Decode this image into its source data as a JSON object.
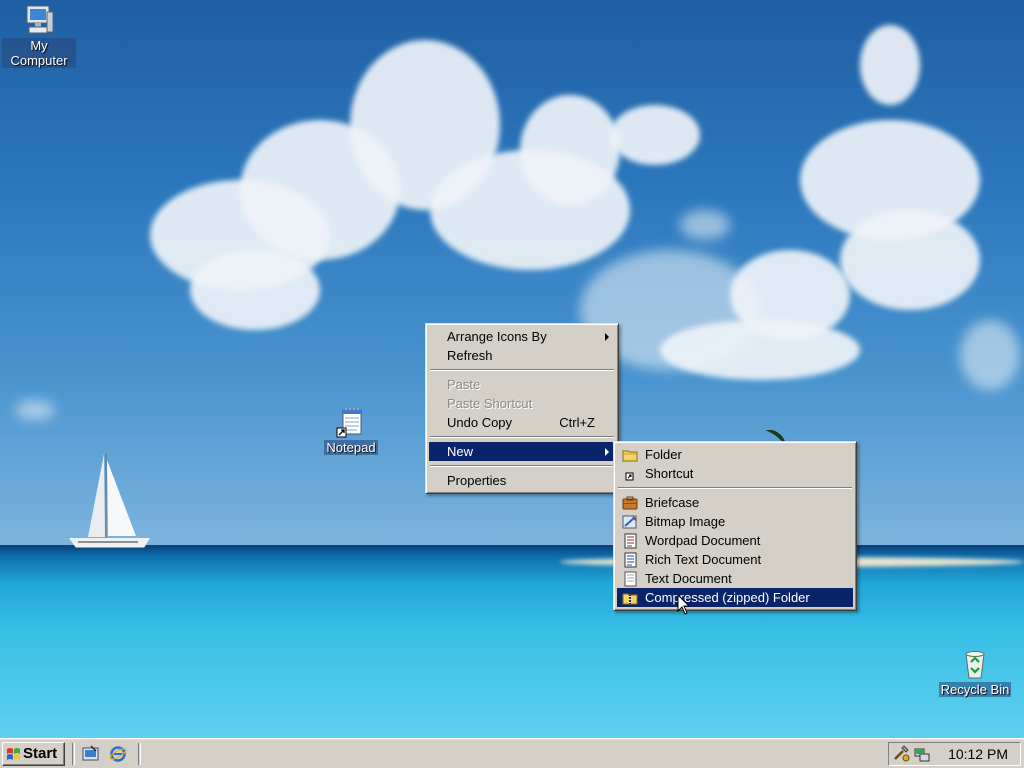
{
  "desktop": {
    "icons": [
      {
        "label": "My Computer"
      },
      {
        "label": "Notepad"
      },
      {
        "label": "Recycle Bin"
      }
    ]
  },
  "context_menu": {
    "items": [
      {
        "label": "Arrange Icons By",
        "submenu": true
      },
      {
        "label": "Refresh"
      },
      {
        "label": "Paste",
        "disabled": true
      },
      {
        "label": "Paste Shortcut",
        "disabled": true
      },
      {
        "label": "Undo Copy",
        "shortcut": "Ctrl+Z"
      },
      {
        "label": "New",
        "submenu": true,
        "selected": true
      },
      {
        "label": "Properties"
      }
    ]
  },
  "new_submenu": {
    "items": [
      {
        "label": "Folder",
        "icon": "folder-icon"
      },
      {
        "label": "Shortcut",
        "icon": "shortcut-icon"
      },
      {
        "label": "Briefcase",
        "icon": "briefcase-icon"
      },
      {
        "label": "Bitmap Image",
        "icon": "bitmap-icon"
      },
      {
        "label": "Wordpad Document",
        "icon": "wordpad-icon"
      },
      {
        "label": "Rich Text Document",
        "icon": "rtf-icon"
      },
      {
        "label": "Text Document",
        "icon": "text-document-icon"
      },
      {
        "label": "Compressed (zipped) Folder",
        "icon": "zip-folder-icon",
        "selected": true
      }
    ]
  },
  "taskbar": {
    "start_label": "Start",
    "clock": "10:12 PM"
  },
  "colors": {
    "menu_face": "#d4d0c8",
    "selection": "#0a246a"
  }
}
